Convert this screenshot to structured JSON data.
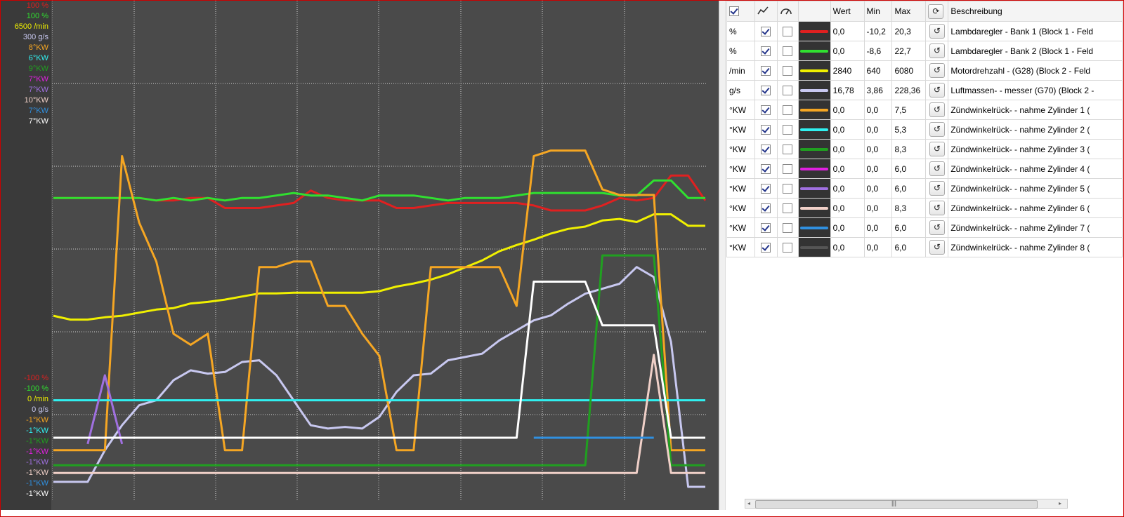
{
  "left_axis": {
    "top_labels": [
      {
        "text": "100 %",
        "color": "#e02020"
      },
      {
        "text": "100 %",
        "color": "#30e030"
      },
      {
        "text": "6500 /min",
        "color": "#f0f000"
      },
      {
        "text": "300 g/s",
        "color": "#c8c8f0"
      },
      {
        "text": "8°KW",
        "color": "#f5a623"
      },
      {
        "text": "6°KW",
        "color": "#30f0f0"
      },
      {
        "text": "9°KW",
        "color": "#20a020"
      },
      {
        "text": "7°KW",
        "color": "#e020e0"
      },
      {
        "text": "7°KW",
        "color": "#a070e0"
      },
      {
        "text": "10°KW",
        "color": "#f0d0c8"
      },
      {
        "text": "7°KW",
        "color": "#3090e0"
      },
      {
        "text": "7°KW",
        "color": "#ffffff"
      }
    ],
    "bottom_labels": [
      {
        "text": "-100 %",
        "color": "#e02020"
      },
      {
        "text": "-100 %",
        "color": "#30e030"
      },
      {
        "text": "0 /min",
        "color": "#f0f000"
      },
      {
        "text": "0 g/s",
        "color": "#c8c8f0"
      },
      {
        "text": "-1°KW",
        "color": "#f5a623"
      },
      {
        "text": "-1°KW",
        "color": "#30f0f0"
      },
      {
        "text": "-1°KW",
        "color": "#20a020"
      },
      {
        "text": "-1°KW",
        "color": "#e020e0"
      },
      {
        "text": "-1°KW",
        "color": "#a070e0"
      },
      {
        "text": "-1°KW",
        "color": "#f0d0c8"
      },
      {
        "text": "-1°KW",
        "color": "#3090e0"
      },
      {
        "text": "-1°KW",
        "color": "#ffffff"
      }
    ]
  },
  "chart_data": {
    "type": "line",
    "grid": true,
    "x": [
      0,
      1,
      2,
      3,
      4,
      5,
      6,
      7,
      8,
      9,
      10,
      11,
      12,
      13,
      14,
      15,
      16,
      17,
      18,
      19,
      20,
      21,
      22,
      23,
      24,
      25,
      26,
      27,
      28,
      29,
      30,
      31,
      32,
      33,
      34,
      35,
      36,
      37,
      38
    ],
    "series": [
      {
        "color": "#e02020",
        "unit": "%",
        "ylim": [
          -100,
          100
        ],
        "values": [
          21,
          21,
          21,
          21,
          21,
          21,
          20,
          20,
          21,
          21,
          17,
          17,
          17,
          18,
          19,
          24,
          21,
          20,
          20,
          20,
          17,
          17,
          18,
          19,
          19,
          19,
          19,
          19,
          18,
          16,
          16,
          16,
          18,
          21,
          20,
          21,
          30,
          30,
          20
        ]
      },
      {
        "color": "#30e030",
        "unit": "%",
        "ylim": [
          -100,
          100
        ],
        "values": [
          21,
          21,
          21,
          21,
          21,
          21,
          20,
          21,
          20,
          21,
          20,
          21,
          21,
          22,
          23,
          22,
          22,
          21,
          20,
          22,
          22,
          22,
          21,
          20,
          21,
          21,
          21,
          22,
          23,
          23,
          23,
          23,
          23,
          22,
          22,
          28,
          28,
          21,
          21
        ]
      },
      {
        "color": "#f0f000",
        "unit": "/min",
        "ylim": [
          0,
          6500
        ],
        "values": [
          2400,
          2350,
          2350,
          2380,
          2400,
          2440,
          2480,
          2500,
          2560,
          2580,
          2610,
          2650,
          2690,
          2690,
          2700,
          2700,
          2700,
          2700,
          2700,
          2720,
          2780,
          2820,
          2870,
          2940,
          3030,
          3120,
          3240,
          3320,
          3390,
          3470,
          3530,
          3560,
          3640,
          3660,
          3620,
          3720,
          3720,
          3570,
          3570
        ]
      },
      {
        "color": "#c8c8f0",
        "unit": "g/s",
        "ylim": [
          0,
          300
        ],
        "values": [
          11,
          11,
          11,
          30,
          45,
          57,
          60,
          72,
          78,
          76,
          77,
          83,
          84,
          75,
          60,
          45,
          43,
          44,
          43,
          50,
          65,
          75,
          76,
          84,
          86,
          88,
          96,
          102,
          108,
          111,
          118,
          124,
          127,
          130,
          140,
          134,
          95,
          8,
          8
        ]
      },
      {
        "color": "#f5a623",
        "unit": "°KW",
        "ylim": [
          -1,
          8
        ],
        "values": [
          -0.1,
          -0.1,
          -0.1,
          -0.1,
          5.2,
          4,
          3.3,
          2,
          1.8,
          2,
          -0.1,
          -0.1,
          3.2,
          3.2,
          3.3,
          3.3,
          2.5,
          2.5,
          2,
          1.6,
          -0.1,
          -0.1,
          3.2,
          3.2,
          3.2,
          3.2,
          3.2,
          2.5,
          5.2,
          5.3,
          5.3,
          5.3,
          4.6,
          4.5,
          4.5,
          4.5,
          -0.1,
          -0.1,
          -0.1
        ]
      },
      {
        "color": "#30f0f0",
        "unit": "°KW",
        "ylim": [
          -1,
          6
        ],
        "values": [
          0.4,
          0.4,
          0.4,
          0.4,
          0.4,
          0.4,
          0.4,
          0.4,
          0.4,
          0.4,
          0.4,
          0.4,
          0.4,
          0.4,
          0.4,
          0.4,
          0.4,
          0.4,
          0.4,
          0.4,
          0.4,
          0.4,
          0.4,
          0.4,
          0.4,
          0.4,
          0.4,
          0.4,
          0.4,
          0.4,
          0.4,
          0.4,
          0.4,
          0.4,
          0.4,
          0.4,
          0.4,
          0.4,
          0.4
        ]
      },
      {
        "color": "#20a020",
        "unit": "°KW",
        "ylim": [
          -1,
          9
        ],
        "values": [
          -0.3,
          -0.3,
          -0.3,
          -0.3,
          -0.3,
          -0.3,
          -0.3,
          -0.3,
          -0.3,
          -0.3,
          -0.3,
          -0.3,
          -0.3,
          -0.3,
          -0.3,
          -0.3,
          -0.3,
          -0.3,
          -0.3,
          -0.3,
          -0.3,
          -0.3,
          -0.3,
          -0.3,
          -0.3,
          -0.3,
          -0.3,
          -0.3,
          -0.3,
          -0.3,
          -0.3,
          -0.3,
          3.9,
          3.9,
          3.9,
          3.9,
          -0.3,
          -0.3,
          -0.3
        ]
      },
      {
        "color": "#a070e0",
        "unit": "°KW",
        "ylim": [
          -1,
          7
        ],
        "values": [
          null,
          null,
          -0.1,
          1.0,
          -0.1,
          null,
          null,
          null,
          null,
          null,
          null,
          null,
          null,
          null,
          null,
          null,
          null,
          null,
          null,
          null,
          null,
          null,
          null,
          null,
          null,
          null,
          null,
          null,
          null,
          null,
          null,
          null,
          null,
          null,
          null,
          null,
          null,
          null,
          null
        ]
      },
      {
        "color": "#f0d0c8",
        "unit": "°KW",
        "ylim": [
          -1,
          10
        ],
        "values": [
          -0.4,
          -0.4,
          -0.4,
          -0.4,
          -0.4,
          -0.4,
          -0.4,
          -0.4,
          -0.4,
          -0.4,
          -0.4,
          -0.4,
          -0.4,
          -0.4,
          -0.4,
          -0.4,
          -0.4,
          -0.4,
          -0.4,
          -0.4,
          -0.4,
          -0.4,
          -0.4,
          -0.4,
          -0.4,
          -0.4,
          -0.4,
          -0.4,
          -0.4,
          -0.4,
          -0.4,
          -0.4,
          -0.4,
          -0.4,
          -0.4,
          2.2,
          -0.4,
          -0.4,
          -0.4
        ]
      },
      {
        "color": "#3090e0",
        "unit": "°KW",
        "ylim": [
          -1,
          7
        ],
        "values": [
          null,
          null,
          null,
          null,
          null,
          null,
          null,
          null,
          null,
          null,
          null,
          null,
          null,
          null,
          null,
          null,
          null,
          null,
          null,
          null,
          null,
          null,
          null,
          null,
          null,
          null,
          null,
          null,
          0,
          0,
          0,
          0,
          0,
          0,
          0,
          0,
          null,
          null,
          null
        ]
      },
      {
        "color": "#ffffff",
        "unit": "°KW",
        "ylim": [
          -1,
          7
        ],
        "values": [
          0,
          0,
          0,
          0,
          0,
          0,
          0,
          0,
          0,
          0,
          0,
          0,
          0,
          0,
          0,
          0,
          0,
          0,
          0,
          0,
          0,
          0,
          0,
          0,
          0,
          0,
          0,
          0,
          2.5,
          2.5,
          2.5,
          2.5,
          1.8,
          1.8,
          1.8,
          1.8,
          0,
          0,
          0
        ]
      }
    ]
  },
  "table": {
    "headers": {
      "wert": "Wert",
      "min": "Min",
      "max": "Max",
      "beschreibung": "Beschreibung"
    },
    "rows": [
      {
        "unit": "%",
        "color": "#e02020",
        "wert": "0,0",
        "min": "-10,2",
        "max": "20,3",
        "desc": "Lambdaregler - Bank 1 (Block 1 - Feld"
      },
      {
        "unit": "%",
        "color": "#30e030",
        "wert": "0,0",
        "min": "-8,6",
        "max": "22,7",
        "desc": "Lambdaregler - Bank 2 (Block 1 - Feld"
      },
      {
        "unit": "/min",
        "color": "#f0f000",
        "wert": "2840",
        "min": "640",
        "max": "6080",
        "desc": "Motordrehzahl - (G28) (Block 2 - Feld"
      },
      {
        "unit": "g/s",
        "color": "#c8c8f0",
        "wert": "16,78",
        "min": "3,86",
        "max": "228,36",
        "desc": "Luftmassen- - messer (G70) (Block 2 -"
      },
      {
        "unit": "°KW",
        "color": "#f5a623",
        "wert": "0,0",
        "min": "0,0",
        "max": "7,5",
        "desc": "Zündwinkelrück- - nahme Zylinder 1 ("
      },
      {
        "unit": "°KW",
        "color": "#30f0f0",
        "wert": "0,0",
        "min": "0,0",
        "max": "5,3",
        "desc": "Zündwinkelrück- - nahme Zylinder 2 ("
      },
      {
        "unit": "°KW",
        "color": "#20a020",
        "wert": "0,0",
        "min": "0,0",
        "max": "8,3",
        "desc": "Zündwinkelrück- - nahme Zylinder 3 ("
      },
      {
        "unit": "°KW",
        "color": "#e020e0",
        "wert": "0,0",
        "min": "0,0",
        "max": "6,0",
        "desc": "Zündwinkelrück- - nahme Zylinder 4 ("
      },
      {
        "unit": "°KW",
        "color": "#a070e0",
        "wert": "0,0",
        "min": "0,0",
        "max": "6,0",
        "desc": "Zündwinkelrück- - nahme Zylinder 5 ("
      },
      {
        "unit": "°KW",
        "color": "#f0d0c8",
        "wert": "0,0",
        "min": "0,0",
        "max": "8,3",
        "desc": "Zündwinkelrück- - nahme Zylinder 6 ("
      },
      {
        "unit": "°KW",
        "color": "#3090e0",
        "wert": "0,0",
        "min": "0,0",
        "max": "6,0",
        "desc": "Zündwinkelrück- - nahme Zylinder 7 ("
      },
      {
        "unit": "°KW",
        "color": "#555555",
        "wert": "0,0",
        "min": "0,0",
        "max": "6,0",
        "desc": "Zündwinkelrück- - nahme Zylinder 8 ("
      }
    ]
  },
  "scrollbar": {
    "grip": "|||"
  }
}
